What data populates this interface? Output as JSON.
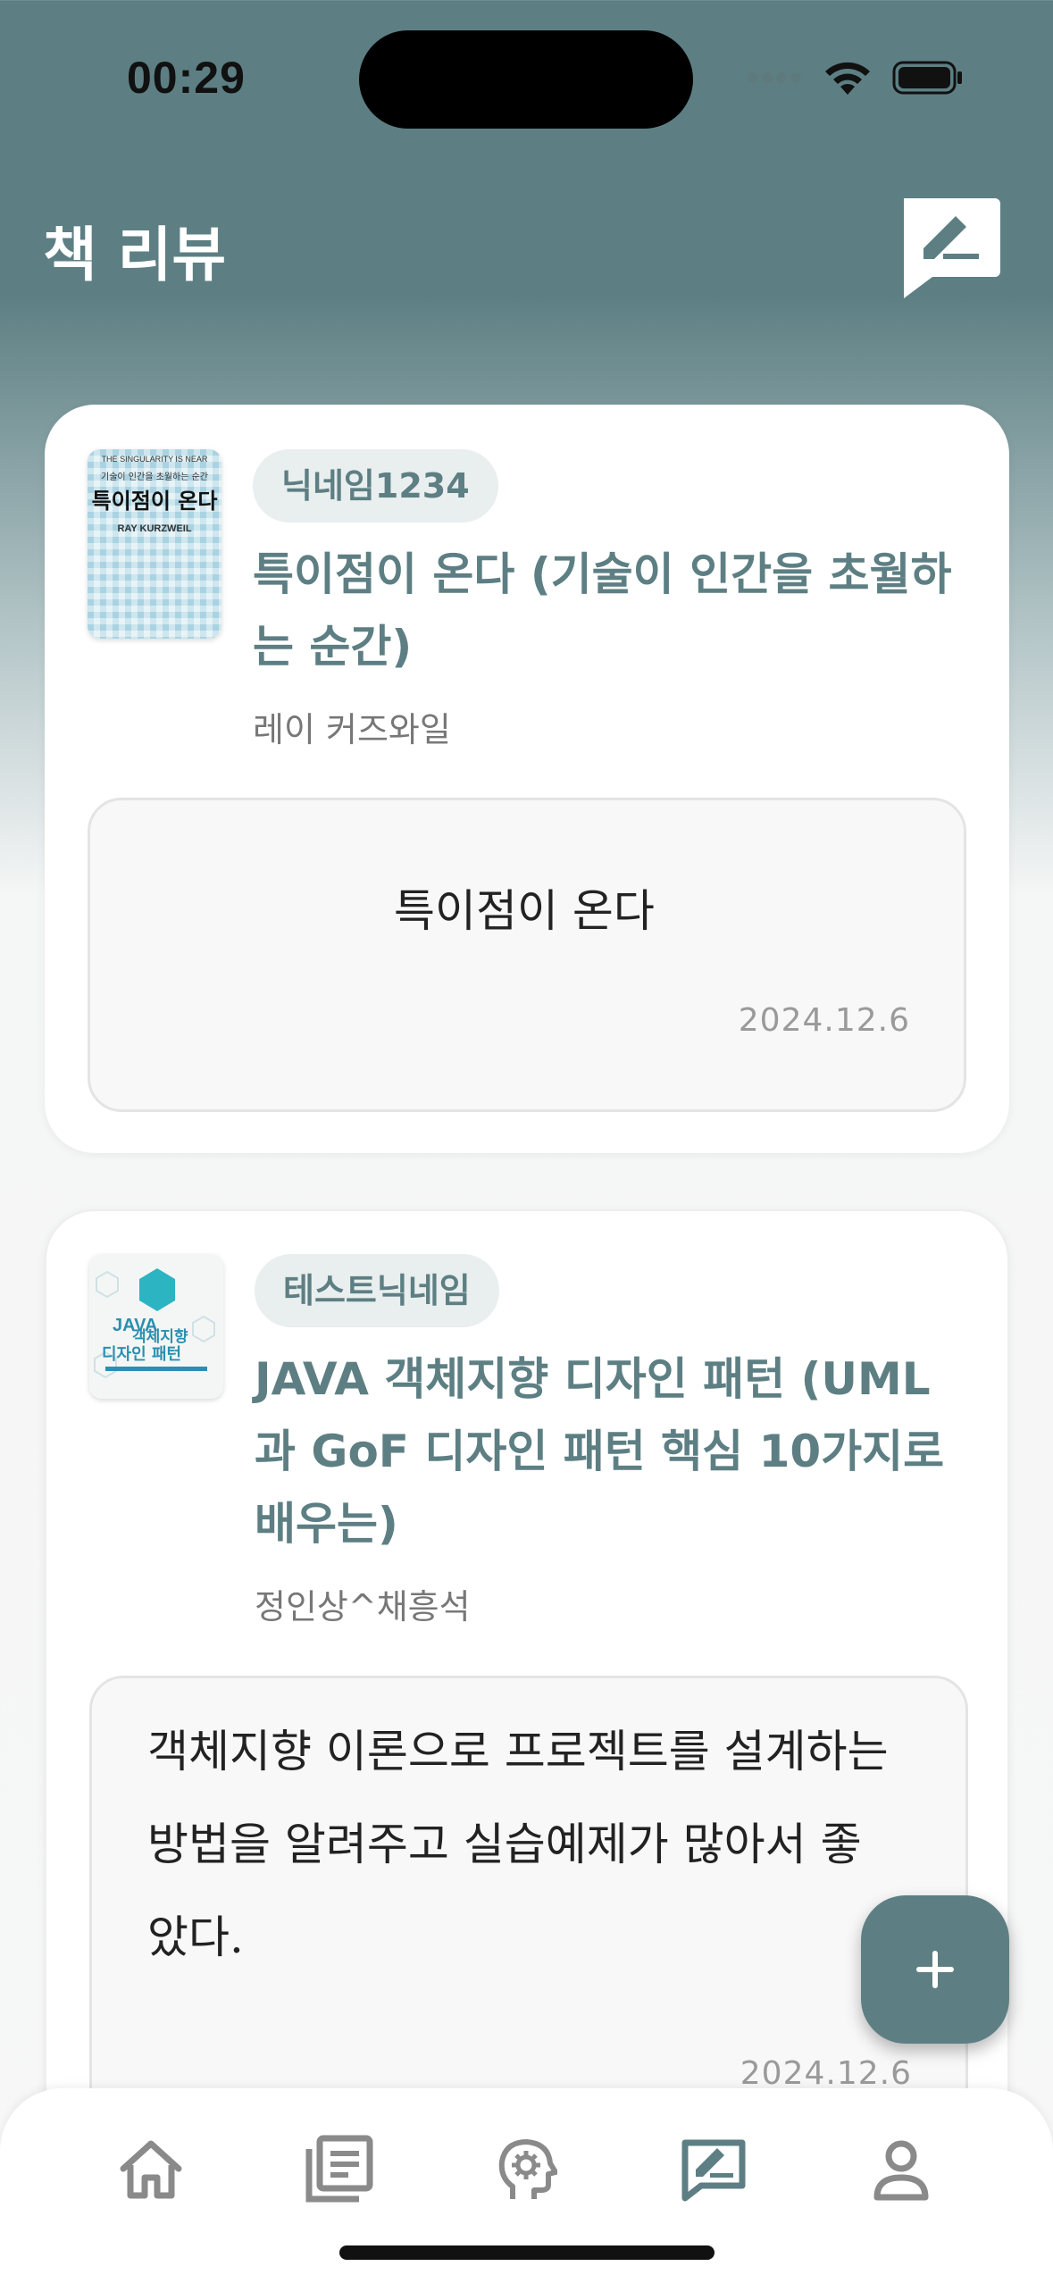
{
  "status_bar": {
    "time": "00:29"
  },
  "header": {
    "title": "책 리뷰"
  },
  "reviews": [
    {
      "nickname": "닉네임1234",
      "book_title": "특이점이 온다 (기술이 인간을 초월하는 순간)",
      "author": "레이 커즈와일",
      "review_text": "특이점이 온다",
      "date": "2024.12.6",
      "cover": {
        "top_text": "THE SINGULARITY IS NEAR",
        "sub_text": "기술이 인간을 초월하는 순간",
        "title": "특이점이 온다",
        "author": "RAY KURZWEIL"
      }
    },
    {
      "nickname": "테스트닉네임",
      "book_title": "JAVA 객체지향 디자인 패턴 (UML과 GoF 디자인 패턴 핵심 10가지로 배우는)",
      "author": "정인상^채흥석",
      "review_text": "객체지향 이론으로 프로젝트를 설계하는 방법을 알려주고 실습예제가 많아서 좋았다.",
      "date": "2024.12.6",
      "cover": {
        "title_line1": "JAVA",
        "title_line2": "객체지향",
        "title_line3": "디자인 패턴"
      }
    }
  ],
  "nav": {
    "items": [
      "home",
      "library",
      "recommend",
      "reviews",
      "profile"
    ],
    "active": "reviews"
  },
  "colors": {
    "accent": "#5d7f83",
    "badge_bg": "#e9eeee"
  }
}
